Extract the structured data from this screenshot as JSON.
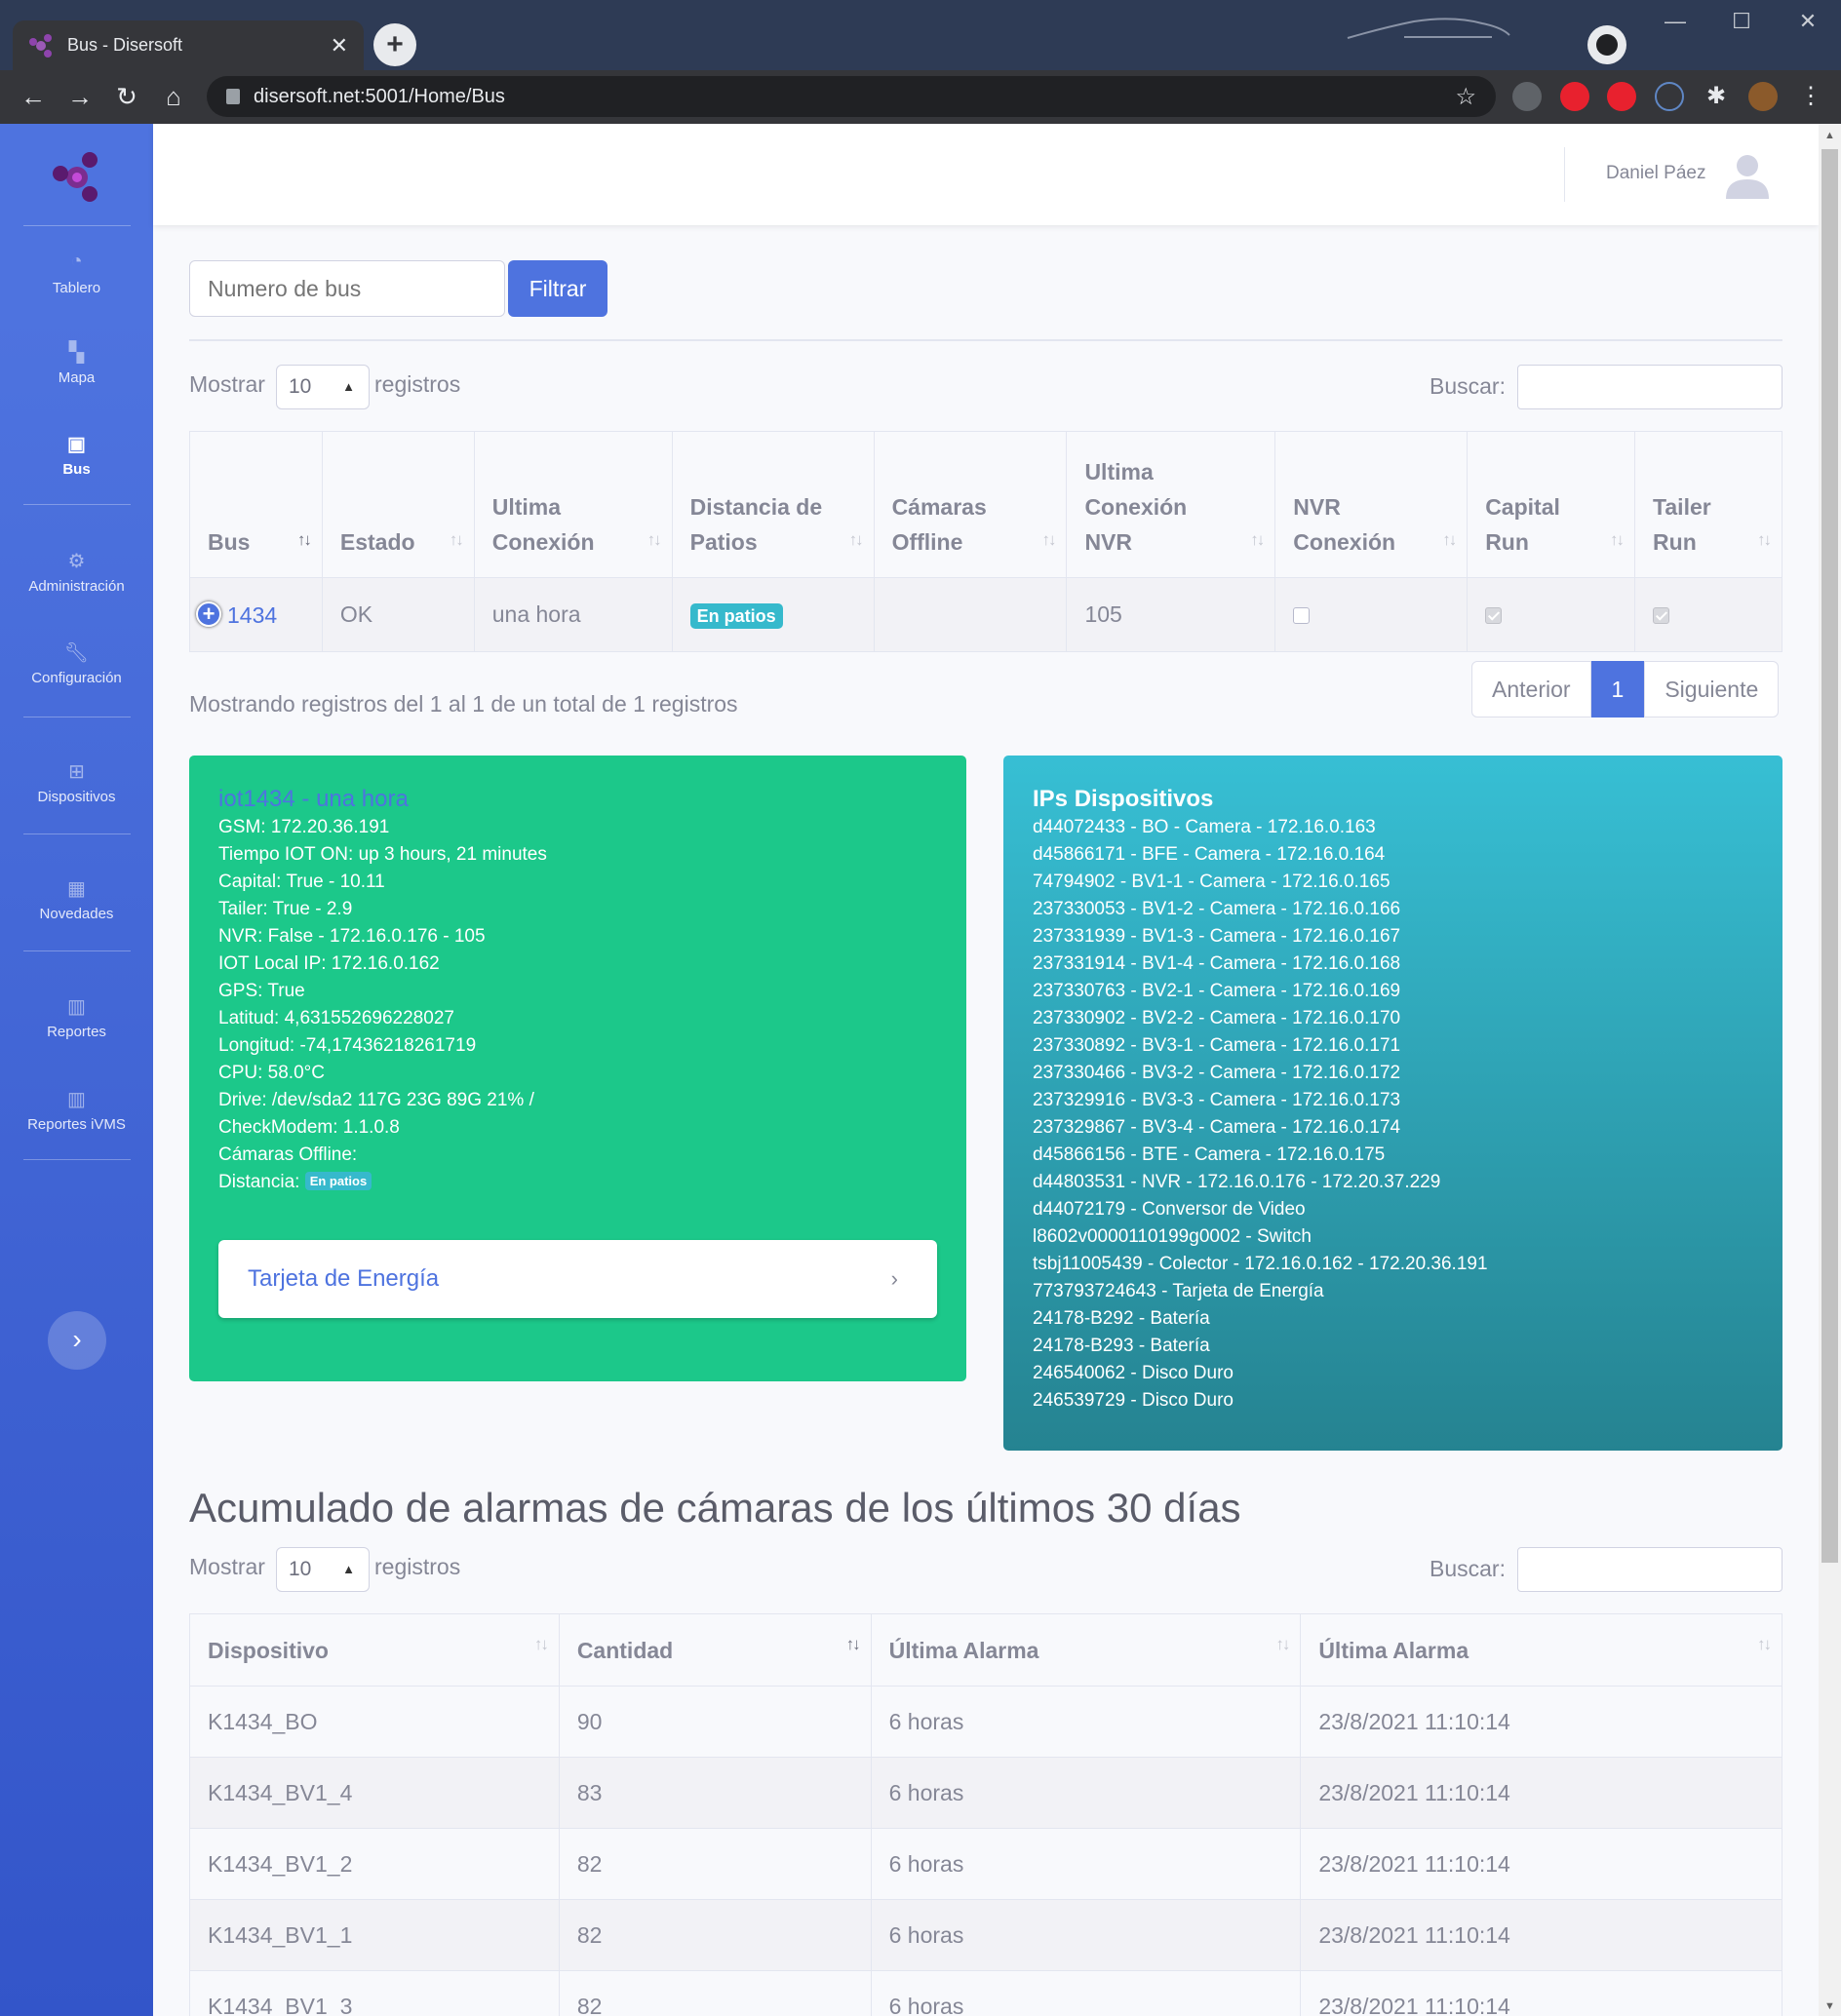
{
  "browser": {
    "tab_title": "Bus - Disersoft",
    "url": "disersoft.net:5001/Home/Bus"
  },
  "sidebar": {
    "items": [
      {
        "label": "Tablero",
        "icon": "tachometer-icon"
      },
      {
        "label": "Mapa",
        "icon": "map-icon"
      },
      {
        "label": "Bus",
        "icon": "bus-icon",
        "active": true
      },
      {
        "label": "Administración",
        "icon": "gear-icon"
      },
      {
        "label": "Configuración",
        "icon": "wrench-icon"
      },
      {
        "label": "Dispositivos",
        "icon": "sitemap-icon"
      },
      {
        "label": "Novedades",
        "icon": "calendar-icon"
      },
      {
        "label": "Reportes",
        "icon": "chart-bar-icon"
      },
      {
        "label": "Reportes iVMS",
        "icon": "chart-bar-icon"
      }
    ]
  },
  "topbar": {
    "user_name": "Daniel Páez"
  },
  "filter": {
    "placeholder": "Numero de bus",
    "button": "Filtrar"
  },
  "bus_table": {
    "show_label": "Mostrar",
    "show_value": "10",
    "records_label": "registros",
    "search_label": "Buscar:",
    "headers": [
      "Bus",
      "Estado",
      "Ultima Conexión",
      "Distancia de Patios",
      "Cámaras Offline",
      "Ultima Conexión NVR",
      "NVR Conexión",
      "Capital Run",
      "Tailer Run"
    ],
    "row": {
      "bus": "1434",
      "estado": "OK",
      "ultima_conexion": "una hora",
      "distancia": "En patios",
      "camaras_offline": "",
      "ultima_nvr": "105",
      "nvr_conexion": false,
      "capital_run": true,
      "tailer_run": true
    },
    "info": "Mostrando registros del 1 al 1 de un total de 1 registros",
    "pager": {
      "prev": "Anterior",
      "current": "1",
      "next": "Siguiente"
    }
  },
  "iot_card": {
    "title": "iot1434 - una hora",
    "lines": [
      "GSM: 172.20.36.191",
      "Tiempo IOT ON: up 3 hours, 21 minutes",
      "Capital: True - 10.11",
      "Tailer: True - 2.9",
      "NVR: False - 172.16.0.176 - 105",
      "IOT Local IP: 172.16.0.162",
      "GPS: True",
      "Latitud: 4,631552696228027",
      "Longitud: -74,17436218261719",
      "CPU: 58.0°C",
      "Drive: /dev/sda2 117G 23G 89G 21% /",
      "CheckModem: 1.1.0.8",
      "Cámaras Offline:"
    ],
    "distance_label": "Distancia:",
    "distance_badge": "En patios",
    "energy_link": "Tarjeta de Energía"
  },
  "ips_card": {
    "title": "IPs Dispositivos",
    "lines": [
      "d44072433 - BO - Camera - 172.16.0.163",
      "d45866171 - BFE - Camera - 172.16.0.164",
      "74794902 - BV1-1 - Camera - 172.16.0.165",
      "237330053 - BV1-2 - Camera - 172.16.0.166",
      "237331939 - BV1-3 - Camera - 172.16.0.167",
      "237331914 - BV1-4 - Camera - 172.16.0.168",
      "237330763 - BV2-1 - Camera - 172.16.0.169",
      "237330902 - BV2-2 - Camera - 172.16.0.170",
      "237330892 - BV3-1 - Camera - 172.16.0.171",
      "237330466 - BV3-2 - Camera - 172.16.0.172",
      "237329916 - BV3-3 - Camera - 172.16.0.173",
      "237329867 - BV3-4 - Camera - 172.16.0.174",
      "d45866156 - BTE - Camera - 172.16.0.175",
      "d44803531 - NVR - 172.16.0.176 - 172.20.37.229",
      "d44072179 - Conversor de Video",
      "l8602v0000110199g0002 - Switch",
      "tsbj11005439 - Colector - 172.16.0.162 - 172.20.36.191",
      "773793724643 - Tarjeta de Energía",
      "24178-B292 - Batería",
      "24178-B293 - Batería",
      "246540062 - Disco Duro",
      "246539729 - Disco Duro"
    ]
  },
  "alarms": {
    "title": "Acumulado de alarmas de cámaras de los últimos 30 días",
    "show_label": "Mostrar",
    "show_value": "10",
    "records_label": "registros",
    "search_label": "Buscar:",
    "headers": [
      "Dispositivo",
      "Cantidad",
      "Última Alarma",
      "Última Alarma"
    ],
    "rows": [
      [
        "K1434_BO",
        "90",
        "6 horas",
        "23/8/2021 11:10:14"
      ],
      [
        "K1434_BV1_4",
        "83",
        "6 horas",
        "23/8/2021 11:10:14"
      ],
      [
        "K1434_BV1_2",
        "82",
        "6 horas",
        "23/8/2021 11:10:14"
      ],
      [
        "K1434_BV1_1",
        "82",
        "6 horas",
        "23/8/2021 11:10:14"
      ],
      [
        "K1434_BV1_3",
        "82",
        "6 horas",
        "23/8/2021 11:10:14"
      ]
    ]
  }
}
